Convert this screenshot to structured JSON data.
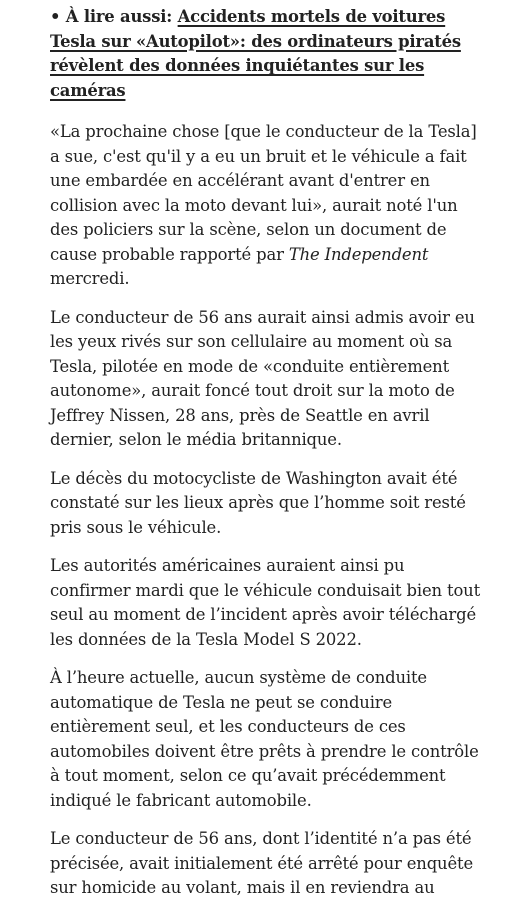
{
  "read_also": {
    "bullet": "•",
    "prefix": "À lire aussi:",
    "link_text": "Accidents mortels de voitures Tesla sur «Autopilot»: des ordinateurs piratés révèlent des données inquiétantes sur les caméras"
  },
  "paragraphs": {
    "p1": {
      "before": "«La prochaine chose [que le conducteur de la Tesla] a sue, c'est qu'il y a eu un bruit et le véhicule a fait une embardée en accélérant avant d'entrer en collision avec la moto devant lui», aurait noté l'un des policiers sur la scène, selon un document de cause probable rapporté par ",
      "source": "The Independent",
      "after": " mercredi."
    },
    "p2": "Le conducteur de 56 ans aurait ainsi admis avoir eu les yeux rivés sur son cellulaire au moment où sa Tesla, pilotée en mode de «conduite entièrement autonome», aurait foncé tout droit sur la moto de Jeffrey Nissen, 28 ans, près de Seattle en avril dernier, selon le média britannique.",
    "p3": "Le décès du motocycliste de Washington avait été constaté sur les lieux après que l’homme soit resté pris sous le véhicule.",
    "p4": "Les autorités américaines auraient ainsi pu confirmer mardi que le véhicule conduisait bien tout seul au moment de l’incident après avoir téléchargé les données de la Tesla Model S 2022.",
    "p5": "À l’heure actuelle, aucun système de conduite automatique de Tesla ne peut se conduire entièrement seul, et les conducteurs de ces automobiles doivent être prêts à prendre le contrôle à tout moment, selon ce qu’avait précédemment indiqué le fabricant automobile.",
    "p6": "Le conducteur de 56 ans, dont l’identité n’a pas été précisée, avait initialement été arrêté pour enquête sur homicide au volant, mais il en reviendra au"
  }
}
